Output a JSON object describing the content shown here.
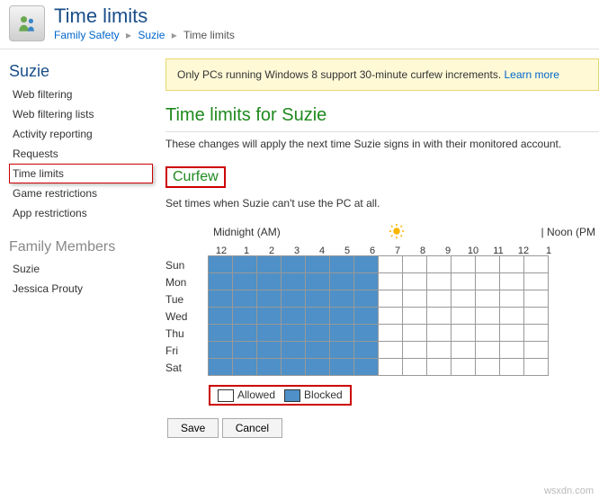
{
  "header": {
    "title": "Time limits",
    "breadcrumb": {
      "root": "Family Safety",
      "user": "Suzie",
      "page": "Time limits"
    }
  },
  "sidebar": {
    "user_heading": "Suzie",
    "items": [
      {
        "label": "Web filtering"
      },
      {
        "label": "Web filtering lists"
      },
      {
        "label": "Activity reporting"
      },
      {
        "label": "Requests"
      },
      {
        "label": "Time limits",
        "selected": true
      },
      {
        "label": "Game restrictions"
      },
      {
        "label": "App restrictions"
      }
    ],
    "family_heading": "Family Members",
    "family": [
      {
        "label": "Suzie"
      },
      {
        "label": "Jessica Prouty"
      }
    ]
  },
  "notice": {
    "text": "Only PCs running Windows 8 support 30-minute curfew increments.",
    "link": "Learn more"
  },
  "content": {
    "title": "Time limits for Suzie",
    "desc": "These changes will apply the next time Suzie signs in with their monitored account.",
    "curfew_heading": "Curfew",
    "curfew_desc": "Set times when Suzie can't use the PC at all.",
    "midnight_label": "Midnight (AM)",
    "noon_label": "| Noon (PM"
  },
  "schedule": {
    "hours": [
      "12",
      "1",
      "2",
      "3",
      "4",
      "5",
      "6",
      "7",
      "8",
      "9",
      "10",
      "11",
      "12",
      "1"
    ],
    "days": [
      "Sun",
      "Mon",
      "Tue",
      "Wed",
      "Thu",
      "Fri",
      "Sat"
    ],
    "blocked_until_hour_index": 7
  },
  "legend": {
    "allowed": "Allowed",
    "blocked": "Blocked"
  },
  "buttons": {
    "save": "Save",
    "cancel": "Cancel"
  },
  "watermark": "wsxdn.com",
  "colors": {
    "blocked": "#4e90c7",
    "heading_blue": "#1a4e8a",
    "heading_green": "#1e8a1e",
    "highlight_border": "#c00",
    "notice_bg": "#fff9d6"
  }
}
